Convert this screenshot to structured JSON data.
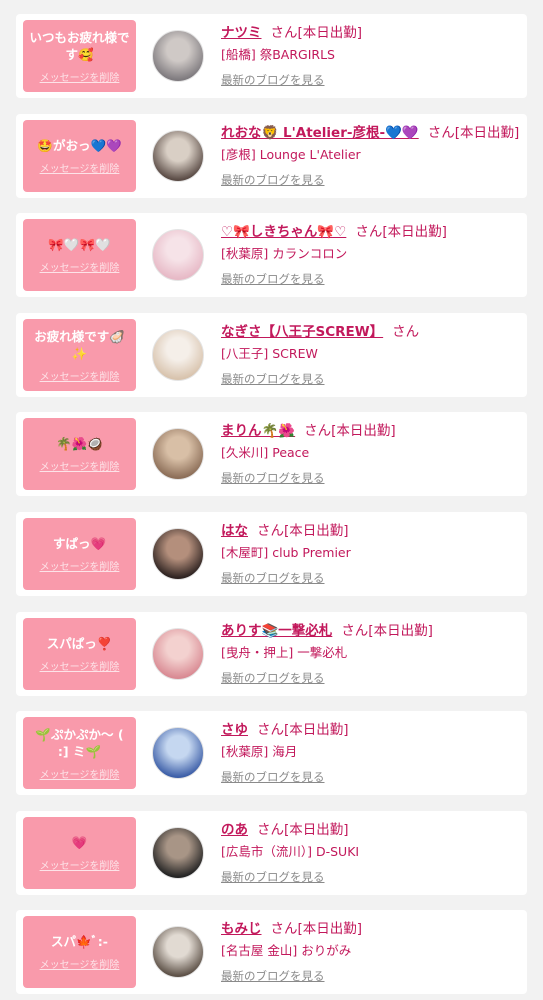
{
  "delete_label": "メッセージを削除",
  "blog_label": "最新のブログを見る",
  "colors": {
    "accent": "#c2185b",
    "message_bg": "#f99aab",
    "page_bg": "#f2f2f2"
  },
  "cards": [
    {
      "message": "いつもお疲れ様です🥰",
      "name": "ナツミ",
      "suffix": "さん[本日出勤]",
      "shop": "[船橋] 祭BARGIRLS",
      "avatar_colors": [
        "#7e7a7e",
        "#cfc9c6"
      ]
    },
    {
      "message": "🤩がおっ💙💜",
      "name": "れおな🦁 L'Atelier-彦根-💙💜",
      "suffix": "さん[本日出勤]",
      "shop": "[彦根] Lounge L'Atelier",
      "avatar_colors": [
        "#5a4b45",
        "#d9cfc5"
      ]
    },
    {
      "message": "🎀🤍🎀🤍",
      "name": "♡🎀しきちゃん🎀♡",
      "suffix": "さん[本日出勤]",
      "shop": "[秋葉原] カランコロン",
      "avatar_colors": [
        "#e7b9c6",
        "#f6e3e8"
      ]
    },
    {
      "message": "お疲れ様です🦪✨",
      "name": "なぎさ【八王子SCREW】",
      "suffix": "さん",
      "shop": "[八王子] SCREW",
      "avatar_colors": [
        "#d8c3ad",
        "#f5efe9"
      ]
    },
    {
      "message": "🌴🌺🥥",
      "name": "まりん🌴🌺",
      "suffix": "さん[本日出勤]",
      "shop": "[久米川] Peace",
      "avatar_colors": [
        "#8c6e58",
        "#d8bfa6"
      ]
    },
    {
      "message": "すぱっ💗",
      "name": "はな",
      "suffix": "さん[本日出勤]",
      "shop": "[木屋町] club Premier",
      "avatar_colors": [
        "#2e2321",
        "#b48f7c"
      ]
    },
    {
      "message": "スパぱっ❣️",
      "name": "ありす📚一撃必札",
      "suffix": "さん[本日出勤]",
      "shop": "[曳舟・押上] 一撃必札",
      "avatar_colors": [
        "#d98a93",
        "#f3d1cf"
      ]
    },
    {
      "message": "🌱ぷかぷか〜 ( :] ミ🌱",
      "name": "さゆ",
      "suffix": "さん[本日出勤]",
      "shop": "[秋葉原] 海月",
      "avatar_colors": [
        "#3d5fa8",
        "#c5d7f0"
      ]
    },
    {
      "message": "💗",
      "name": "のあ",
      "suffix": "さん[本日出勤]",
      "shop": "[広島市（流川）] D-SUKI",
      "avatar_colors": [
        "#242424",
        "#a89586"
      ]
    },
    {
      "message": "スパ🍁ﾞ:-",
      "name": "もみじ",
      "suffix": "さん[本日出勤]",
      "shop": "[名古屋 金山] おりがみ",
      "avatar_colors": [
        "#5d5147",
        "#e1dad2"
      ]
    }
  ]
}
